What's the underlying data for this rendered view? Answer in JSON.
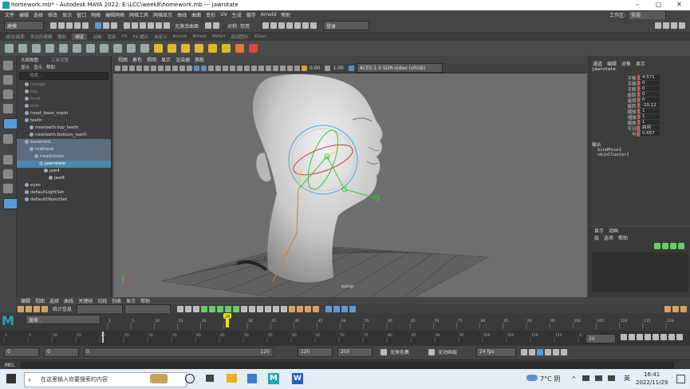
{
  "window": {
    "title": "homework.mb* - Autodesk MAYA 2022: E:\\LCC\\week8\\homework.mb   ---   jawrotate",
    "controls": [
      "–",
      "▢",
      "✕"
    ]
  },
  "menubar": [
    "文件",
    "编辑",
    "选择",
    "修改",
    "显示",
    "窗口",
    "网格",
    "编辑网格",
    "网格工具",
    "网格显示",
    "曲线",
    "曲面",
    "变形",
    "UV",
    "生成",
    "缓存",
    "Arnold",
    "帮助"
  ],
  "workspace": {
    "label": "工作区:",
    "value": "常规"
  },
  "statusline": {
    "mode": "建模",
    "symmetry": "无激活曲面",
    "sym_field": "对称: 禁用",
    "login": "登录"
  },
  "shelf_tabs": [
    "曲线/曲面",
    "多边形建模",
    "雕刻",
    "绑定",
    "动画",
    "渲染",
    "FX",
    "FX 缓存",
    "自定义",
    "Arnold",
    "Bifrost",
    "MASH",
    "运动图形",
    "XGen"
  ],
  "shelf_active": "绑定",
  "outliner": {
    "tabs": [
      "大纲视图",
      "工具设置"
    ],
    "menu": [
      "显示",
      "显示",
      "帮助"
    ],
    "search_placeholder": "搜索...",
    "items": [
      {
        "label": "lounge",
        "indent": 1,
        "dim": true
      },
      {
        "label": "top",
        "indent": 1,
        "dim": true
      },
      {
        "label": "front",
        "indent": 1,
        "dim": true
      },
      {
        "label": "side",
        "indent": 1,
        "dim": true
      },
      {
        "label": "head_base_mesh",
        "indent": 1
      },
      {
        "label": "teeth",
        "indent": 1
      },
      {
        "label": "newteeth:top_teeth",
        "indent": 2
      },
      {
        "label": "newteeth:bottom_teeth",
        "indent": 2
      },
      {
        "label": "baseneck",
        "indent": 1,
        "hl": true
      },
      {
        "label": "midneck",
        "indent": 2,
        "hl": true
      },
      {
        "label": "headrotate",
        "indent": 3,
        "hl": true
      },
      {
        "label": "jawrotate",
        "indent": 4,
        "cur": true
      },
      {
        "label": "jaw4",
        "indent": 5
      },
      {
        "label": "jaw8",
        "indent": 6
      },
      {
        "label": "eyes",
        "indent": 1
      },
      {
        "label": "defaultLightSet",
        "indent": 1
      },
      {
        "label": "defaultObjectSet",
        "indent": 1
      }
    ]
  },
  "viewport": {
    "menu": [
      "视图",
      "着色",
      "照明",
      "显示",
      "渲染器",
      "面板"
    ],
    "exposure": "0.00",
    "gamma": "1.00",
    "colorspace": "ACES 1.0 SDR-video (sRGB)",
    "camera_label": "persp"
  },
  "channelbox": {
    "menu": [
      "通道",
      "编辑",
      "对象",
      "显示"
    ],
    "object": "jawrotate",
    "channels": [
      {
        "label": "平移 X",
        "value": "4.571"
      },
      {
        "label": "平移 Y",
        "value": "0"
      },
      {
        "label": "平移 Z",
        "value": "0"
      },
      {
        "label": "旋转 X",
        "value": "0"
      },
      {
        "label": "旋转 Y",
        "value": "0"
      },
      {
        "label": "旋转 Z",
        "value": "-20.12"
      },
      {
        "label": "缩放 X",
        "value": "1"
      },
      {
        "label": "缩放 Y",
        "value": "1"
      },
      {
        "label": "缩放 Z",
        "value": "1"
      },
      {
        "label": "可见性",
        "value": "启用"
      },
      {
        "label": "半径",
        "value": "0.667"
      }
    ],
    "outputs_header": "输出",
    "outputs": [
      "bindPose1",
      "skinCluster1"
    ]
  },
  "layers": {
    "tabs": [
      "显示",
      "动画"
    ],
    "menu": [
      "层",
      "选项",
      "帮助"
    ]
  },
  "timeline": {
    "menu": [
      "编辑",
      "视图",
      "选择",
      "曲线",
      "关键帧",
      "切线",
      "列表",
      "显示",
      "帮助"
    ],
    "field_label": "统计信息",
    "search_placeholder": "搜索...",
    "ticks": [
      "1",
      "5",
      "10",
      "15",
      "20",
      "25",
      "30",
      "35",
      "40",
      "45",
      "50",
      "55",
      "60",
      "65",
      "70",
      "75",
      "80",
      "85",
      "90",
      "95",
      "100",
      "105",
      "110",
      "115",
      "120"
    ],
    "current_frame": "20",
    "current_frame_field": "20"
  },
  "range": {
    "start": "0",
    "inner_start": "0",
    "inner_end": "120",
    "end_field": "120",
    "max_field": "200",
    "char_set": "无角色集",
    "anim_layer": "无动画层",
    "fps": "24 fps"
  },
  "cmd": {
    "label": "MEL"
  },
  "taskbar": {
    "search_placeholder": "在这里输入你要搜索的内容",
    "weather": "7°C 阴",
    "ime": "英",
    "time": "16:41",
    "date": "2022/11/29"
  },
  "colors": {
    "accent_blue": "#5285a6",
    "key_red": "#c9595b",
    "timeline_marker": "#e8e020",
    "viewport_bg": "#6e6e6e"
  }
}
